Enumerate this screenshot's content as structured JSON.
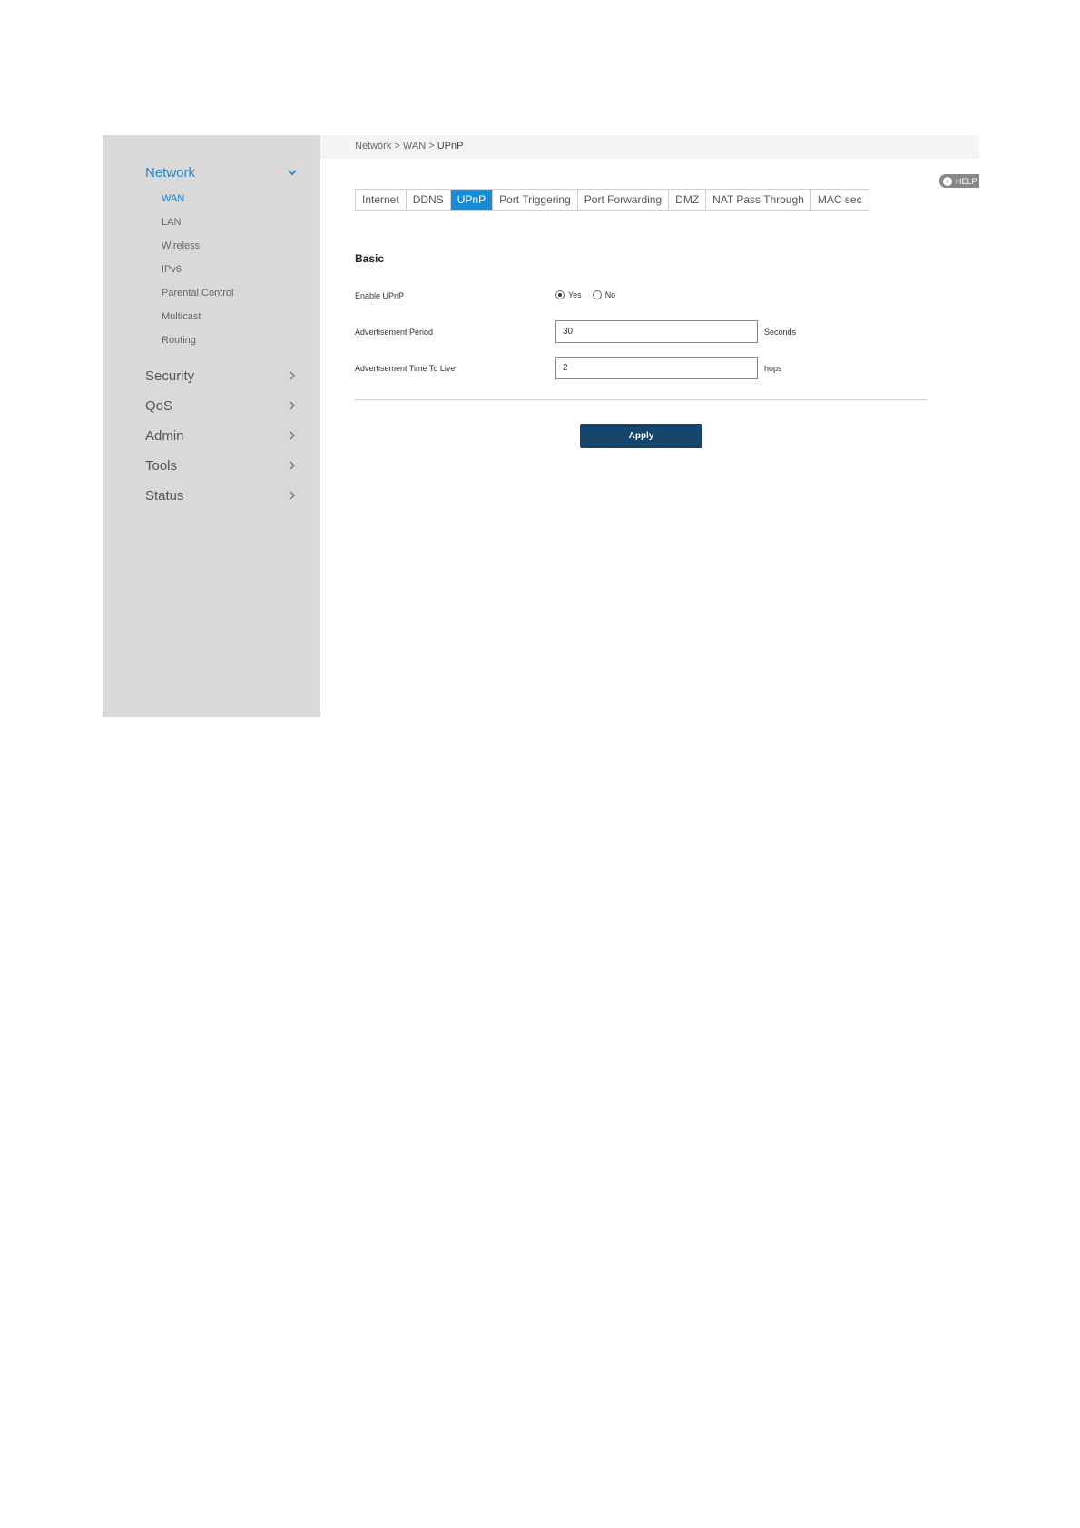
{
  "sidebar": {
    "network": {
      "label": "Network"
    },
    "sub_items": [
      {
        "label": "WAN",
        "active": true
      },
      {
        "label": "LAN"
      },
      {
        "label": "Wireless"
      },
      {
        "label": "IPv6"
      },
      {
        "label": "Parental Control"
      },
      {
        "label": "Multicast"
      },
      {
        "label": "Routing"
      }
    ],
    "items": [
      {
        "label": "Security"
      },
      {
        "label": "QoS"
      },
      {
        "label": "Admin"
      },
      {
        "label": "Tools"
      },
      {
        "label": "Status"
      }
    ]
  },
  "breadcrumb": {
    "part1": "Network",
    "sep1": ">",
    "part2": "WAN",
    "sep2": ">",
    "current": "UPnP"
  },
  "help": {
    "label": "HELP"
  },
  "tabs": [
    {
      "label": "Internet"
    },
    {
      "label": "DDNS"
    },
    {
      "label": "UPnP",
      "active": true
    },
    {
      "label": "Port Triggering"
    },
    {
      "label": "Port Forwarding"
    },
    {
      "label": "DMZ"
    },
    {
      "label": "NAT Pass Through"
    },
    {
      "label": "MAC sec"
    }
  ],
  "form": {
    "section_title": "Basic",
    "enable_upnp": {
      "label": "Enable UPnP",
      "yes_label": "Yes",
      "no_label": "No",
      "selected": "Yes"
    },
    "ad_period": {
      "label": "Advertisement Period",
      "value": "30",
      "unit": "Seconds"
    },
    "ad_ttl": {
      "label": "Advertisement Time To Live",
      "value": "2",
      "unit": "hops"
    },
    "apply_label": "Apply"
  },
  "colors": {
    "accent": "#1a8ad4",
    "button": "#16466b",
    "sidebar": "#d9d9d9"
  }
}
